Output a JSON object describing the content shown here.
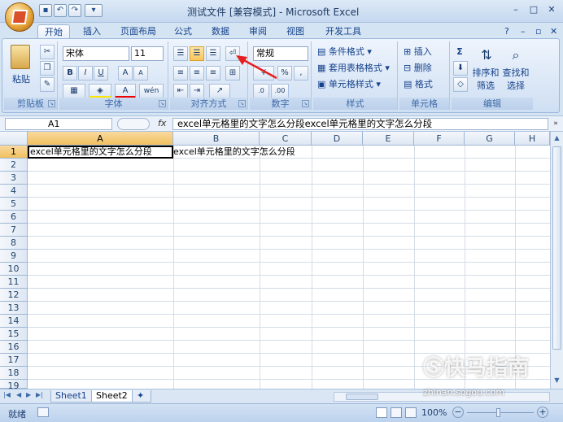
{
  "window": {
    "title": "测试文件 [兼容模式] - Microsoft Excel",
    "controls": {
      "minimize": "–",
      "maximize": "□",
      "close": "✕"
    },
    "help": "?",
    "ribbon_min": "–",
    "ribbon_restore": "▫",
    "ribbon_close": "✕"
  },
  "quick_access": {
    "save": "▪",
    "undo": "↶",
    "redo": "↷",
    "more": "▾"
  },
  "tabs": [
    "开始",
    "插入",
    "页面布局",
    "公式",
    "数据",
    "审阅",
    "视图",
    "开发工具"
  ],
  "active_tab": "开始",
  "ribbon": {
    "clipboard": {
      "label": "剪贴板",
      "paste": "粘贴"
    },
    "font": {
      "label": "字体",
      "name": "宋体",
      "size": "11",
      "bold": "B",
      "italic": "I",
      "underline": "U",
      "grow": "A",
      "shrink": "A",
      "font_color": "A",
      "phonetic": "wén"
    },
    "alignment": {
      "label": "对齐方式"
    },
    "number": {
      "label": "数字",
      "format": "常规",
      "percent": "%",
      "comma": ",",
      "inc_decimal": ".0",
      "dec_decimal": ".00"
    },
    "styles": {
      "label": "样式",
      "conditional": "条件格式",
      "table": "套用表格格式",
      "cell_styles": "单元格样式"
    },
    "cells": {
      "label": "单元格",
      "insert": "插入",
      "delete": "删除",
      "format": "格式"
    },
    "editing": {
      "label": "编辑",
      "sum": "Σ",
      "sort": "排序和",
      "sort2": "筛选",
      "find": "查找和",
      "find2": "选择"
    }
  },
  "formula_bar": {
    "cell_ref": "A1",
    "fx": "fx",
    "content": "excel单元格里的文字怎么分段excel单元格里的文字怎么分段"
  },
  "columns": [
    "A",
    "B",
    "C",
    "D",
    "E",
    "F",
    "G",
    "H"
  ],
  "rows": [
    "1",
    "2",
    "3",
    "4",
    "5",
    "6",
    "7",
    "8",
    "9",
    "10",
    "11",
    "12",
    "13",
    "14",
    "15",
    "16",
    "17",
    "18",
    "19"
  ],
  "cells": {
    "a1": "excel单元格里的文字怎么分段",
    "b1": "excel单元格里的文字怎么分段"
  },
  "sheets": [
    "Sheet1",
    "Sheet2"
  ],
  "active_sheet": "Sheet2",
  "status": {
    "ready": "就绪",
    "zoom": "100%",
    "zoom_out": "−",
    "zoom_in": "+"
  },
  "watermark": {
    "text": "快马指南",
    "url": "zhinan.sogou.com"
  },
  "colors": {
    "accent": "#15428b",
    "selected_header": "#f1c15f",
    "annotation_arrow": "#e52020"
  }
}
